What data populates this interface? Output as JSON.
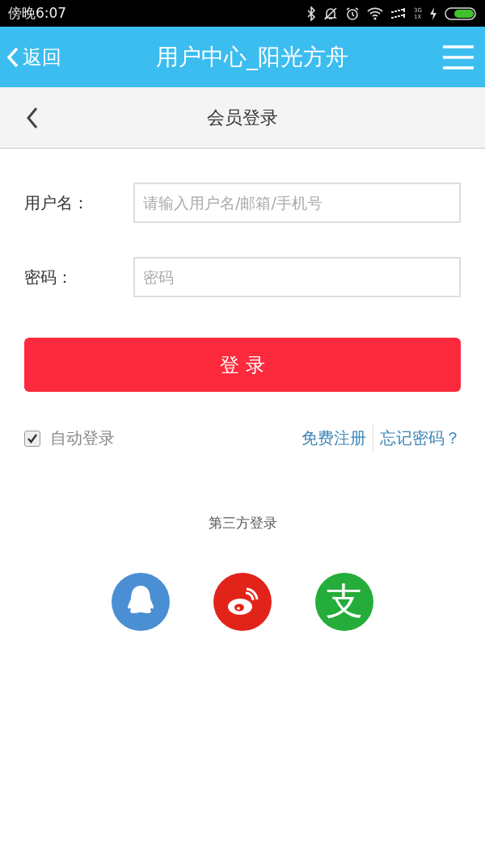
{
  "status_bar": {
    "time": "傍晚6:07",
    "network": [
      "3G",
      "1X"
    ]
  },
  "app_bar": {
    "back": "返回",
    "title": "用户中心_阳光方舟"
  },
  "header": {
    "title": "会员登录"
  },
  "form": {
    "fields": [
      {
        "label": "用户名：",
        "placeholder": "请输入用户名/邮箱/手机号"
      },
      {
        "label": "密码：",
        "placeholder": "密码"
      }
    ],
    "submit": "登 录",
    "auto_login": {
      "label": "自动登录",
      "checked": true
    },
    "links": [
      "免费注册",
      "忘记密码？"
    ]
  },
  "third_party": {
    "title": "第三方登录",
    "providers": [
      {
        "kind": "qq"
      },
      {
        "kind": "weibo"
      },
      {
        "kind": "alipay",
        "glyph": "支"
      }
    ]
  }
}
